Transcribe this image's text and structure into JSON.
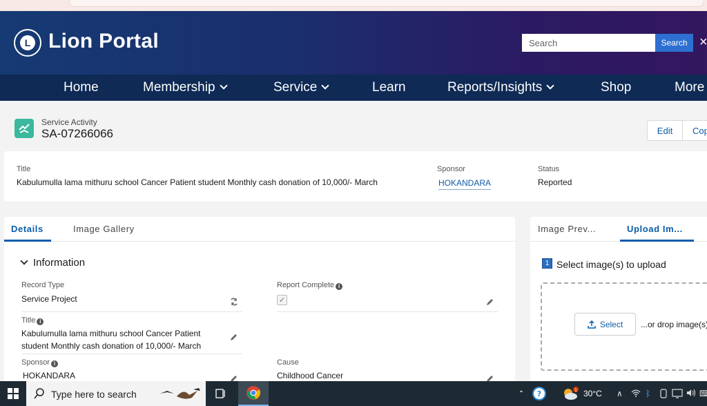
{
  "header": {
    "brand": "Lion Portal",
    "search_placeholder": "Search",
    "search_button": "Search",
    "close": "×"
  },
  "nav": {
    "items": [
      {
        "label": "Home"
      },
      {
        "label": "Membership"
      },
      {
        "label": "Service"
      },
      {
        "label": "Learn"
      },
      {
        "label": "Reports/Insights"
      },
      {
        "label": "Shop"
      },
      {
        "label": "More"
      }
    ]
  },
  "record": {
    "type_label": "Service Activity",
    "id": "SA-07266066",
    "edit_label": "Edit",
    "copy_label": "Cop"
  },
  "highlights": {
    "title_label": "Title",
    "title_value": "Kabulumulla lama mithuru school Cancer Patient student Monthly cash donation of 10,000/- March",
    "sponsor_label": "Sponsor",
    "sponsor_value": "HOKANDARA",
    "status_label": "Status",
    "status_value": "Reported"
  },
  "details": {
    "tabs": [
      {
        "label": "Details"
      },
      {
        "label": "Image Gallery"
      }
    ],
    "section_title": "Information",
    "record_type_label": "Record Type",
    "record_type_value": "Service Project",
    "report_complete_label": "Report Complete",
    "report_complete_checked": true,
    "title_label": "Title",
    "title_line1": "Kabulumulla lama mithuru school Cancer Patient",
    "title_line2": "student Monthly cash donation of 10,000/- March",
    "sponsor_label": "Sponsor",
    "sponsor_value": "HOKANDARA",
    "cause_label": "Cause",
    "cause_value": "Childhood Cancer"
  },
  "upload": {
    "tabs": [
      {
        "label": "Image Prev..."
      },
      {
        "label": "Upload Im..."
      }
    ],
    "step_number": "1",
    "step_title": "Select image(s) to upload",
    "select_label": "Select",
    "drop_text": "...or drop image(s)"
  },
  "taskbar": {
    "search_placeholder": "Type here to search",
    "weather_badge": "1",
    "temperature": "30°C"
  },
  "colors": {
    "header_start": "#163a73",
    "header_end": "#33175f",
    "nav": "#0e2a55",
    "accent": "#0b5cab",
    "search_button": "#2e6fd2",
    "record_icon": "#3bb89d"
  }
}
